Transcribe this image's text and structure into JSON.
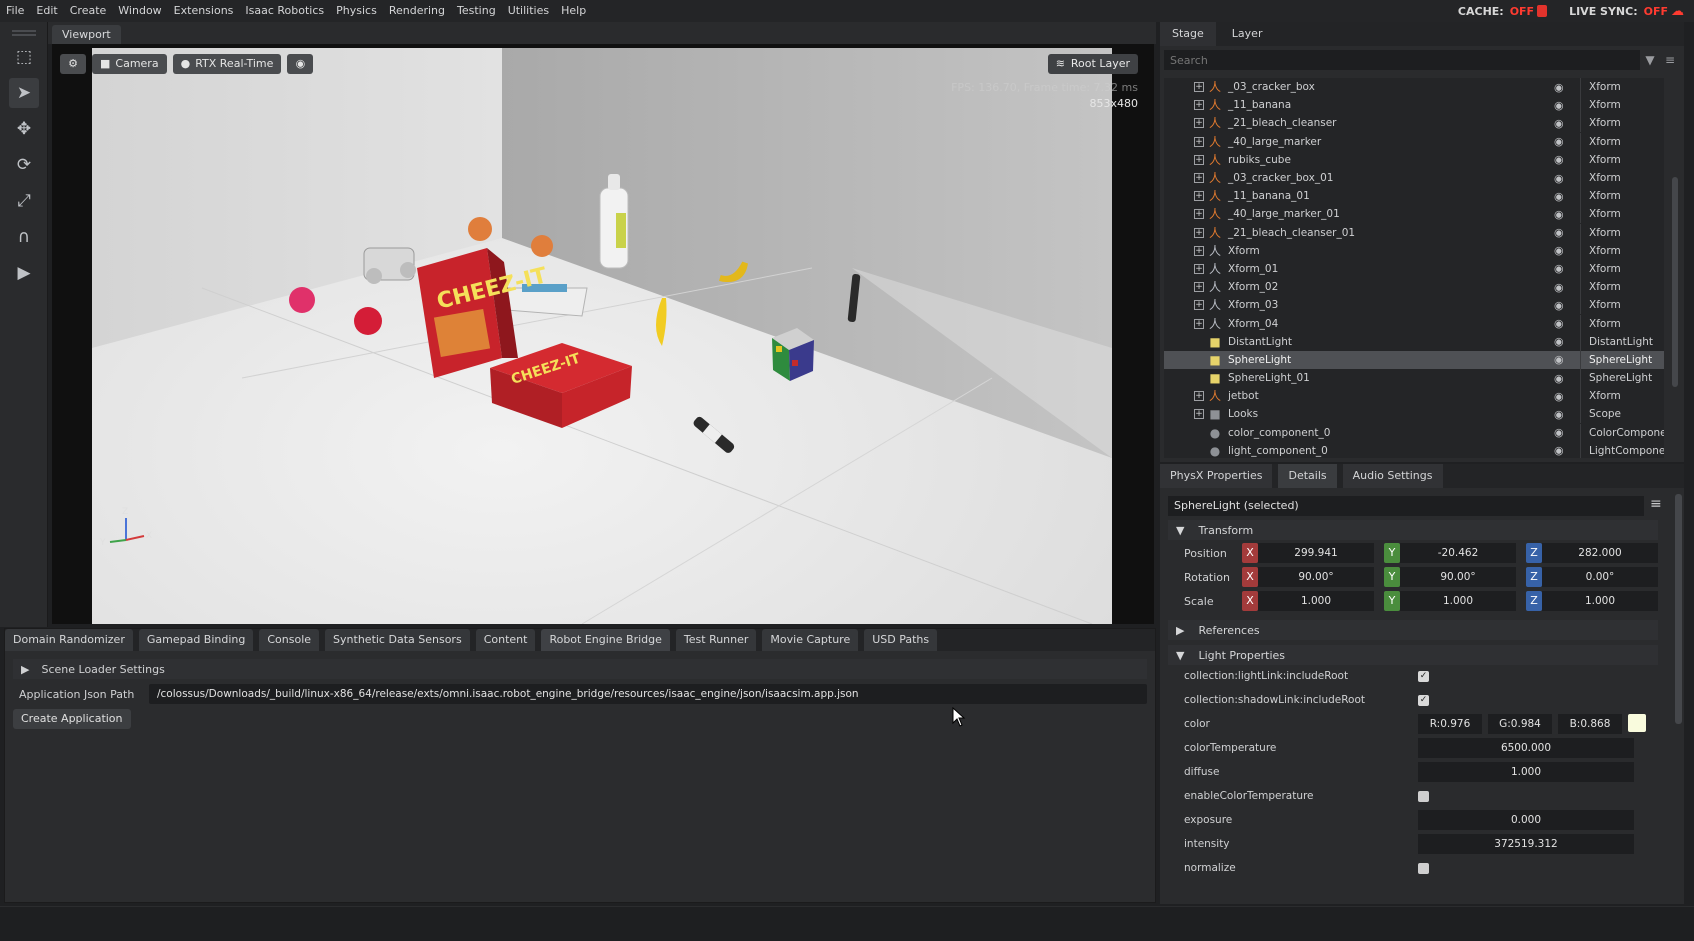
{
  "menu": {
    "items": [
      "File",
      "Edit",
      "Create",
      "Window",
      "Extensions",
      "Isaac Robotics",
      "Physics",
      "Rendering",
      "Testing",
      "Utilities",
      "Help"
    ],
    "cache_label": "CACHE:",
    "cache_state": "OFF",
    "live_sync_label": "LIVE SYNC:",
    "live_sync_state": "OFF"
  },
  "viewport": {
    "tab": "Viewport",
    "camera_label": "Camera",
    "render_label": "RTX Real-Time",
    "root_layer_label": "Root Layer",
    "fps_text": "FPS: 136.70, Frame time: 7.32 ms",
    "resolution": "853x480",
    "axis_labels": {
      "z": "Z",
      "y": "Y",
      "x": "X"
    }
  },
  "bottom": {
    "tabs": [
      "Domain Randomizer",
      "Gamepad Binding",
      "Console",
      "Synthetic Data Sensors",
      "Content",
      "Robot Engine Bridge",
      "Test Runner",
      "Movie Capture",
      "USD Paths"
    ],
    "scene_loader_label": "Scene Loader Settings",
    "json_path_label": "Application Json Path",
    "json_path_value": "/colossus/Downloads/_build/linux-x86_64/release/exts/omni.isaac.robot_engine_bridge/resources/isaac_engine/json/isaacsim.app.json",
    "create_button": "Create Application"
  },
  "stage": {
    "tabs": [
      "Stage",
      "Layer"
    ],
    "search_placeholder": "Search",
    "rows": [
      {
        "name": "_03_cracker_box",
        "type": "Xform",
        "icon": "xform-orange"
      },
      {
        "name": "_11_banana",
        "type": "Xform",
        "icon": "xform-orange"
      },
      {
        "name": "_21_bleach_cleanser",
        "type": "Xform",
        "icon": "xform-orange"
      },
      {
        "name": "_40_large_marker",
        "type": "Xform",
        "icon": "xform-orange"
      },
      {
        "name": "rubiks_cube",
        "type": "Xform",
        "icon": "xform-orange"
      },
      {
        "name": "_03_cracker_box_01",
        "type": "Xform",
        "icon": "xform-orange"
      },
      {
        "name": "_11_banana_01",
        "type": "Xform",
        "icon": "xform-orange"
      },
      {
        "name": "_40_large_marker_01",
        "type": "Xform",
        "icon": "xform-orange"
      },
      {
        "name": "_21_bleach_cleanser_01",
        "type": "Xform",
        "icon": "xform-orange"
      },
      {
        "name": "Xform",
        "type": "Xform",
        "icon": "xform-gray"
      },
      {
        "name": "Xform_01",
        "type": "Xform",
        "icon": "xform-gray"
      },
      {
        "name": "Xform_02",
        "type": "Xform",
        "icon": "xform-gray"
      },
      {
        "name": "Xform_03",
        "type": "Xform",
        "icon": "xform-gray"
      },
      {
        "name": "Xform_04",
        "type": "Xform",
        "icon": "xform-gray"
      },
      {
        "name": "DistantLight",
        "type": "DistantLight",
        "icon": "light"
      },
      {
        "name": "SphereLight",
        "type": "SphereLight",
        "icon": "light"
      },
      {
        "name": "SphereLight_01",
        "type": "SphereLight",
        "icon": "light"
      },
      {
        "name": "jetbot",
        "type": "Xform",
        "icon": "xform-orange"
      },
      {
        "name": "Looks",
        "type": "Scope",
        "icon": "folder"
      },
      {
        "name": "color_component_0",
        "type": "ColorComponent",
        "icon": "component"
      },
      {
        "name": "light_component_0",
        "type": "LightComponent",
        "icon": "component"
      }
    ]
  },
  "properties": {
    "tabs": [
      "PhysX Properties",
      "Details",
      "Audio Settings"
    ],
    "selected_prim": "SphereLight (selected)",
    "transform_section": "Transform",
    "position_label": "Position",
    "rotation_label": "Rotation",
    "scale_label": "Scale",
    "position": {
      "x": "299.941",
      "y": "-20.462",
      "z": "282.000"
    },
    "rotation": {
      "x": "90.00°",
      "y": "90.00°",
      "z": "0.00°"
    },
    "scale": {
      "x": "1.000",
      "y": "1.000",
      "z": "1.000"
    },
    "axis": {
      "x": "X",
      "y": "Y",
      "z": "Z"
    },
    "references_section": "References",
    "light_section": "Light Properties",
    "light_props": {
      "include_root_label": "collection:lightLink:includeRoot",
      "shadow_root_label": "collection:shadowLink:includeRoot",
      "color_label": "color",
      "color_r": "R:0.976",
      "color_g": "G:0.984",
      "color_b": "B:0.868",
      "color_swatch": "#f9fbdd",
      "temperature_label": "colorTemperature",
      "temperature": "6500.000",
      "diffuse_label": "diffuse",
      "diffuse": "1.000",
      "enable_temp_label": "enableColorTemperature",
      "exposure_label": "exposure",
      "exposure": "0.000",
      "intensity_label": "intensity",
      "intensity": "372519.312",
      "normalize_label": "normalize"
    }
  }
}
